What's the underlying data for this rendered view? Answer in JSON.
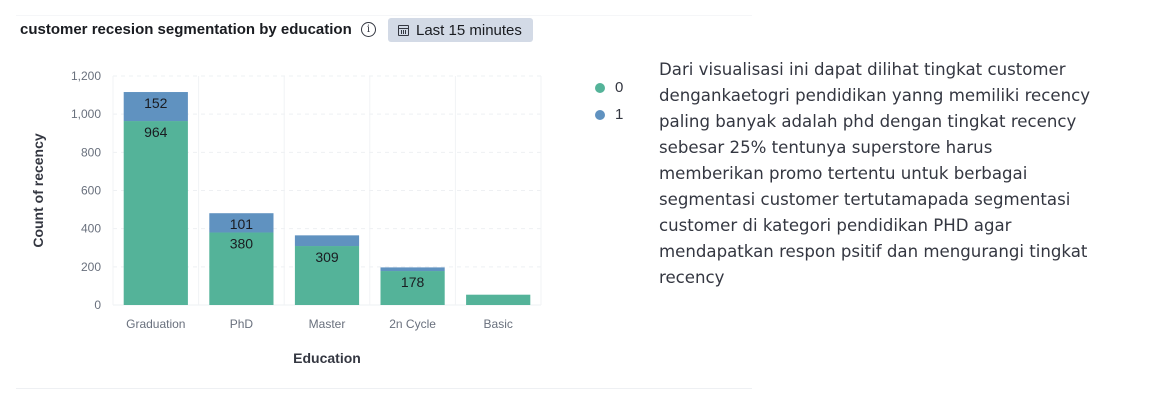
{
  "panel": {
    "title": "customer recesion segmentation by education",
    "info_icon": "info-icon",
    "time_range": "Last 15 minutes",
    "time_icon": "calendar-icon"
  },
  "description": "Dari visualisasi ini dapat dilihat tingkat customer dengankaetogri pendidikan yanng memiliki recency paling banyak adalah phd dengan tingkat recency sebesar 25% tentunya superstore harus memberikan promo tertentu untuk berbagai segmentasi customer tertutamapada segmentasi customer di kategori pendidikan PHD agar mendapatkan respon psitif dan mengurangi tingkat recency",
  "chart_data": {
    "type": "bar",
    "stacked": true,
    "categories": [
      "Graduation",
      "PhD",
      "Master",
      "2n Cycle",
      "Basic"
    ],
    "series": [
      {
        "name": "0",
        "color": "#54b399",
        "values": [
          964,
          380,
          309,
          178,
          54
        ],
        "labels": [
          "964",
          "380",
          "309",
          "178",
          ""
        ]
      },
      {
        "name": "1",
        "color": "#6092c0",
        "values": [
          152,
          101,
          56,
          19,
          0
        ],
        "labels": [
          "152",
          "101",
          "",
          "",
          ""
        ]
      }
    ],
    "xlabel": "Education",
    "ylabel": "Count of recency",
    "ylim": [
      0,
      1200
    ],
    "yticks": [
      0,
      200,
      400,
      600,
      800,
      1000,
      1200
    ],
    "ytick_labels": [
      "0",
      "200",
      "400",
      "600",
      "800",
      "1,000",
      "1,200"
    ],
    "grid": true,
    "legend_position": "right"
  }
}
